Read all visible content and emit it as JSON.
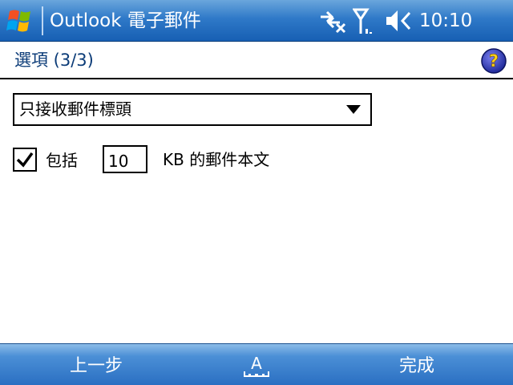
{
  "titlebar": {
    "start_icon": "windows-flag-icon",
    "title": "Outlook 電子郵件",
    "status_icons": [
      "connectivity-icon",
      "signal-strength-icon",
      "volume-icon"
    ],
    "time": "10:10"
  },
  "header": {
    "title": "選項 (3/3)",
    "help_icon": "help-icon"
  },
  "options": {
    "download_mode": {
      "selected": "只接收郵件標頭"
    },
    "include_body": {
      "checked": true,
      "label": "包括",
      "kb_value": "10",
      "suffix": "KB 的郵件本文"
    }
  },
  "menubar": {
    "left_label": "上一步",
    "right_label": "完成",
    "input_panel_icon": "keyboard-input-panel-icon"
  },
  "colors": {
    "titlebar_blue": "#2f79c8",
    "heading_text": "#0c3c78",
    "menubar_blue": "#2a6fc2"
  }
}
